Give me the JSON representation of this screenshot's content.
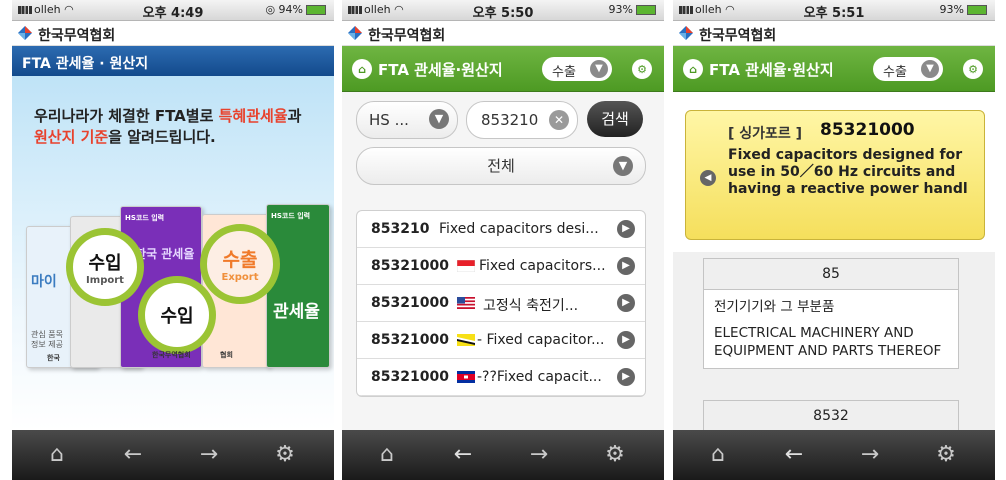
{
  "screens": [
    {
      "status": {
        "carrier": "olleh",
        "time": "오후 4:49",
        "battery": "◎ 94%"
      },
      "brand": "한국무역협회",
      "nav_title": "FTA 관세율 · 원산지",
      "hero": {
        "line1_a": "우리나라가 체결한 FTA별로 ",
        "line1_b": "특혜관세율",
        "line1_c": "과",
        "line2_a": "원산지 기준",
        "line2_b": "을 알려드립니다.",
        "book_left_a": "마이",
        "book_left_b": "관심 품목",
        "book_left_c": "정보 제공",
        "book_top": "HS코드 입력",
        "book_mid": "한국 관세율",
        "book_right_top": "HS코드 입력",
        "book_right": "관세율",
        "book_right_small": "협회",
        "ring_left": "수입",
        "ring_left_sub": "Import",
        "ring_center": "수입",
        "ring_right": "수출",
        "ring_right_sub": "Export",
        "footer_left": "한국",
        "footer_center": "한국무역협회"
      }
    },
    {
      "status": {
        "carrier": "olleh",
        "time": "오후 5:50",
        "battery": "93%"
      },
      "brand": "한국무역협회",
      "nav_title": "FTA 관세율·원산지",
      "export_select": "수출",
      "hs_select": "HS ...",
      "code_input": "853210",
      "search_button": "검색",
      "filter_select": "전체",
      "results": [
        {
          "code": "853210",
          "desc": "Fixed capacitors desi...",
          "flag": ""
        },
        {
          "code": "85321000",
          "desc": "Fixed capacitors...",
          "flag": "singapore-flag"
        },
        {
          "code": "85321000",
          "desc": "고정식 축전기...",
          "flag": "usa-flag"
        },
        {
          "code": "85321000",
          "desc": "- Fixed capacitor...",
          "flag": "brunei-flag"
        },
        {
          "code": "85321000",
          "desc": "-??Fixed capacit...",
          "flag": "cambodia-flag"
        }
      ]
    },
    {
      "status": {
        "carrier": "olleh",
        "time": "오후 5:51",
        "battery": "93%"
      },
      "brand": "한국무역협회",
      "nav_title": "FTA 관세율·원산지",
      "export_select": "수출",
      "detail": {
        "country": "[ 싱가포르 ]",
        "code": "85321000",
        "desc": "Fixed capacitors designed for use in 50／60 Hz circuits and having a reactive power handl"
      },
      "tables": [
        {
          "head": "85",
          "ko": "전기기기와 그 부분품",
          "en": "ELECTRICAL MACHINERY AND EQUIPMENT AND PARTS THEREOF"
        },
        {
          "head": "8532",
          "ko": "",
          "en": ""
        }
      ]
    }
  ],
  "toolbar_icons": [
    "home-icon",
    "back-arrow-icon",
    "forward-arrow-icon",
    "settings-gear-icon"
  ],
  "colors": {
    "green": "#5aa62d",
    "blue": "#1d58a0",
    "yellow": "#f7e57a",
    "accent_red": "#e8422d"
  }
}
